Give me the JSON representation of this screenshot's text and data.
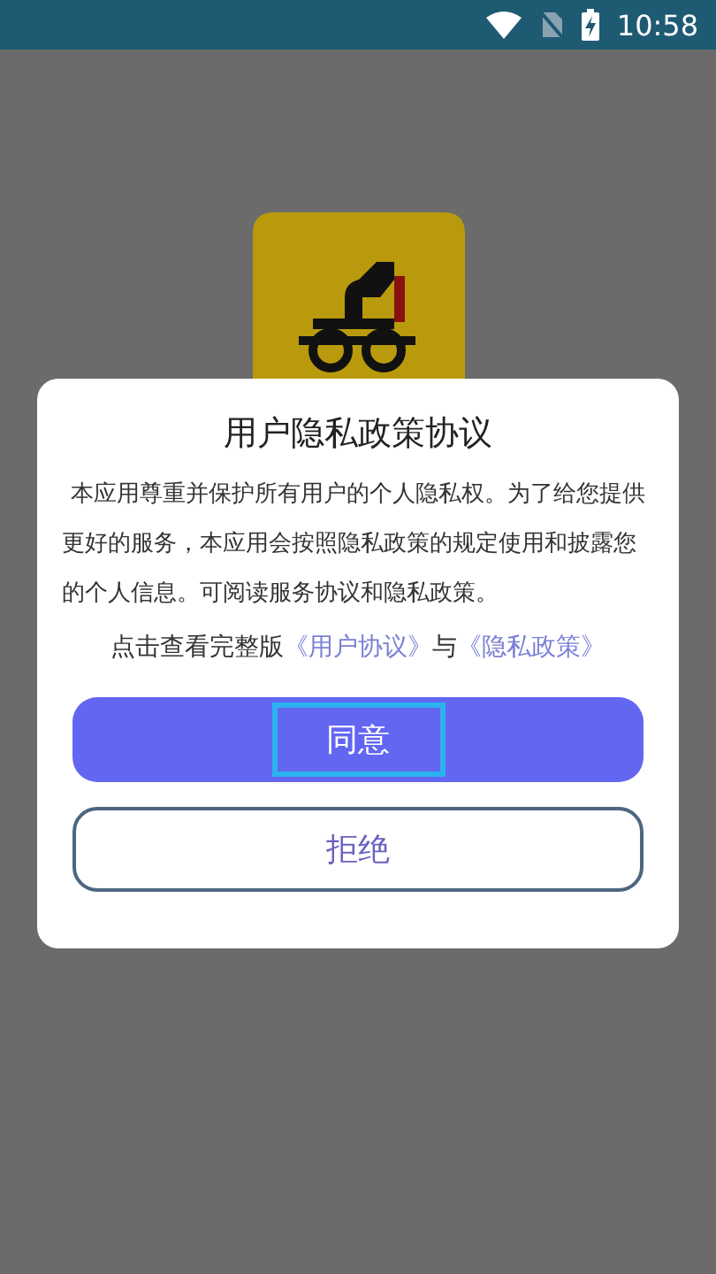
{
  "status_bar": {
    "time": "10:58"
  },
  "dialog": {
    "title": "用户隐私政策协议",
    "body": "本应用尊重并保护所有用户的个人隐私权。为了给您提供更好的服务，本应用会按照隐私政策的规定使用和披露您的个人信息。可阅读服务协议和隐私政策。",
    "notice": [
      {
        "kind": "text",
        "text": "点击查看完整版"
      },
      {
        "kind": "link",
        "text": "《用户协议》"
      },
      {
        "kind": "text",
        "text": "与"
      },
      {
        "kind": "link",
        "text": "《隐私政策》"
      }
    ],
    "buttons": [
      {
        "label": "同意",
        "kind": "primary",
        "focused": true
      },
      {
        "label": "拒绝",
        "kind": "outline",
        "focused": false
      }
    ]
  }
}
